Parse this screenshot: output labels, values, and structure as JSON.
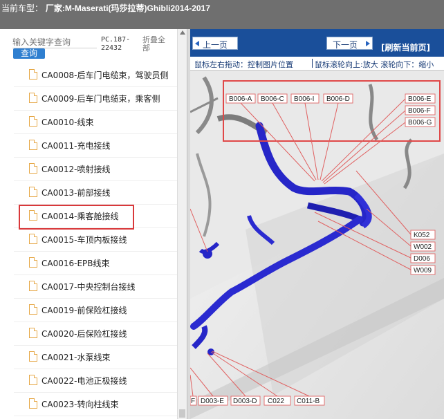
{
  "header": {
    "prefix": "当前车型：",
    "vehicle_label": "厂家:M-Maserati(玛莎拉蒂)Ghibli2014-2017"
  },
  "search": {
    "placeholder": "输入关键字查询",
    "button_label": "查询",
    "code_label": "PC.187-22432",
    "collapse_label": "折叠全部"
  },
  "tree": {
    "items": [
      {
        "label": "CA0008-后车门电缆束，驾驶员侧"
      },
      {
        "label": "CA0009-后车门电缆束，乘客侧"
      },
      {
        "label": "CA0010-线束"
      },
      {
        "label": "CA0011-充电接线"
      },
      {
        "label": "CA0012-喷射接线"
      },
      {
        "label": "CA0013-前部接线"
      },
      {
        "label": "CA0014-乘客舱接线",
        "selected": true
      },
      {
        "label": "CA0015-车顶内板接线"
      },
      {
        "label": "CA0016-EPB线束"
      },
      {
        "label": "CA0017-中央控制台接线"
      },
      {
        "label": "CA0019-前保险杠接线"
      },
      {
        "label": "CA0020-后保险杠接线"
      },
      {
        "label": "CA0021-水泵线束"
      },
      {
        "label": "CA0022-电池正极接线"
      },
      {
        "label": "CA0023-转向柱线束"
      }
    ]
  },
  "viewer": {
    "prev_label": "上一页",
    "next_label": "下一页",
    "refresh_label": "[刷新当前页]",
    "hint_drag": "鼠标左右拖动：控制图片位置",
    "hint_scroll": "鼠标滚轮向上:放大  滚轮向下：缩小"
  },
  "diagram": {
    "top_labels": [
      "B006-A",
      "B006-C",
      "B006-I",
      "B006-D",
      "B006-E",
      "B006-F",
      "B006-G"
    ],
    "right_labels": [
      "K052",
      "W002",
      "D006",
      "W009"
    ],
    "bottom_labels": [
      "F",
      "D003-E",
      "D003-D",
      "C022",
      "C011-B"
    ]
  },
  "colors": {
    "title_bar": "#6f6f6f",
    "nav_bar": "#1a4f9a",
    "highlight_box": "#d9383a",
    "harness": "#2626c8",
    "label_border": "#e07070"
  }
}
